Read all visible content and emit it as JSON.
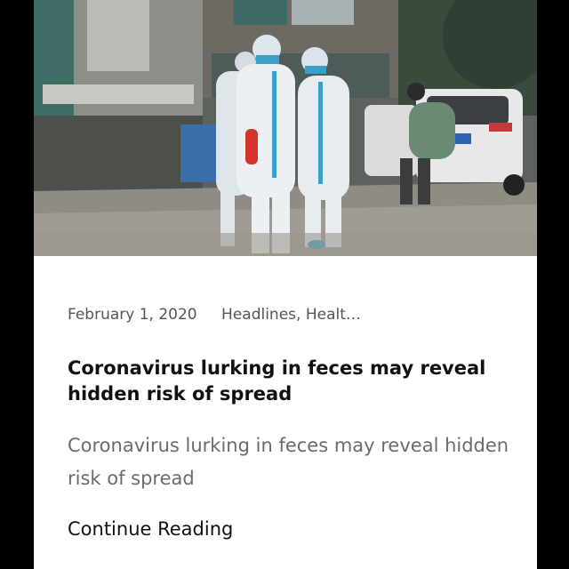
{
  "post": {
    "image_alt": "Workers in protective suits spraying disinfectant on a street",
    "date": "February 1, 2020",
    "categories": "Headlines, Healt…",
    "title": "Coronavirus lurking in feces may reveal hidden risk of spread",
    "excerpt": "Coronavirus lurking in feces may reveal hidden risk of spread",
    "read_more": "Continue Reading"
  },
  "colors": {
    "background": "#000000",
    "card": "#ffffff",
    "title": "#111111",
    "meta": "#555555",
    "excerpt": "#6b6b6b"
  }
}
